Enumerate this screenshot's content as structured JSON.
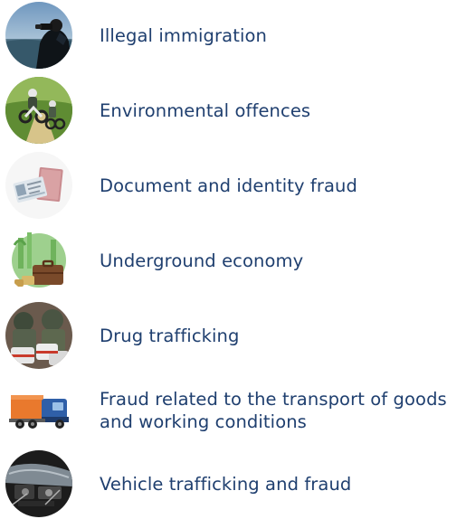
{
  "items": [
    {
      "label": "Illegal immigration",
      "icon": "binoculars-icon"
    },
    {
      "label": "Environmental offences",
      "icon": "motorbike-icon"
    },
    {
      "label": "Document and identity fraud",
      "icon": "id-card-icon"
    },
    {
      "label": "Underground economy",
      "icon": "briefcase-icon"
    },
    {
      "label": "Drug trafficking",
      "icon": "drug-packages-icon"
    },
    {
      "label": "Fraud related to the transport of goods and working conditions",
      "icon": "truck-icon"
    },
    {
      "label": "Vehicle trafficking and fraud",
      "icon": "car-engine-icon"
    }
  ],
  "colors": {
    "text": "#1f3f6f"
  }
}
